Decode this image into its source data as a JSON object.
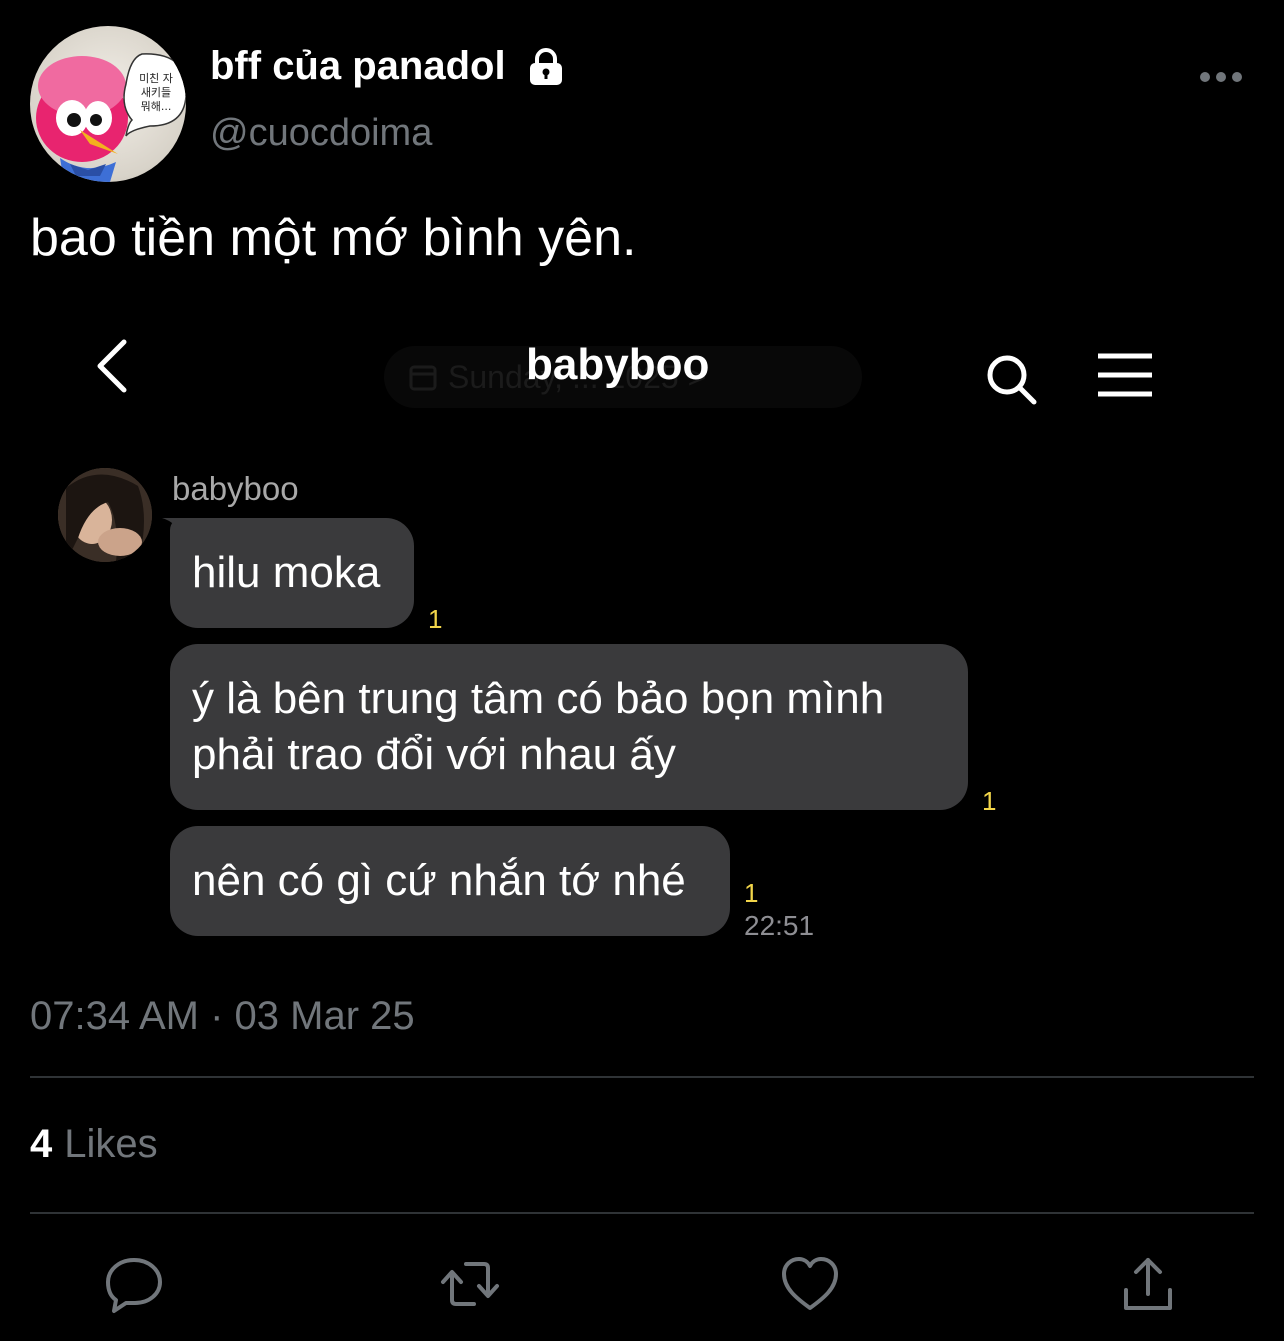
{
  "tweet": {
    "author_name": "bff của panadol",
    "handle": "@cuocdoima",
    "text": "bao tiền một mớ bình yên.",
    "timestamp": "07:34 AM · 03 Mar 25",
    "likes_count": "4",
    "likes_label": "Likes",
    "avatar_speech_text": "미친 자 새키들 뭐해..."
  },
  "icons": {
    "lock": "lock-icon",
    "more": "more-icon",
    "reply": "reply-icon",
    "retweet": "retweet-icon",
    "like": "heart-icon",
    "share": "share-icon"
  },
  "chat": {
    "title": "babyboo",
    "ghost_date": "Sunday, ... 2025 >",
    "sender_name": "babyboo",
    "messages": [
      {
        "lines": [
          "hilu moka"
        ],
        "unread": "1"
      },
      {
        "lines": [
          "ý là bên trung tâm có bảo bọn mình",
          "phải trao đổi với nhau ấy"
        ],
        "unread": "1"
      },
      {
        "lines": [
          "nên có gì cứ nhắn tớ nhé"
        ],
        "unread": "1",
        "time": "22:51"
      }
    ],
    "icons": {
      "back": "back-icon",
      "search": "search-icon",
      "menu": "menu-icon"
    }
  },
  "colors": {
    "background": "#000000",
    "bubble": "#3a3a3c",
    "unread": "#f2d54a",
    "muted": "#71767b"
  }
}
